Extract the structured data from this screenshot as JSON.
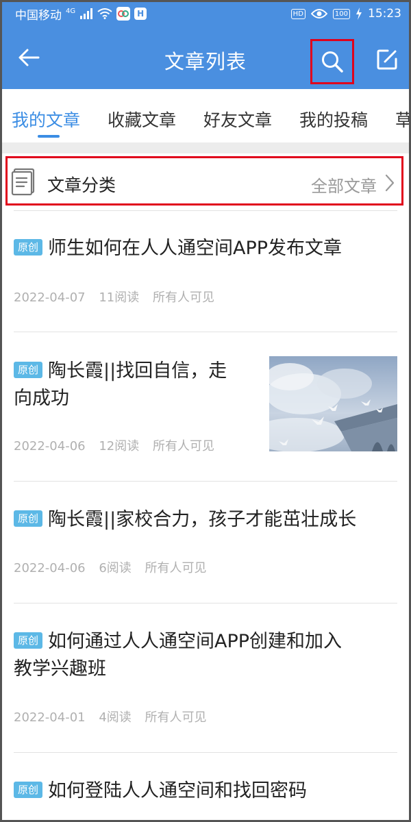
{
  "status_bar": {
    "carrier": "中国移动",
    "network": "4G",
    "hd": "HD",
    "battery": "100",
    "time": "15:23"
  },
  "header": {
    "title": "文章列表",
    "back_icon": "arrow-left-icon",
    "search_icon": "search-icon",
    "edit_icon": "edit-icon"
  },
  "tabs": [
    {
      "label": "我的文章",
      "active": true
    },
    {
      "label": "收藏文章",
      "active": false
    },
    {
      "label": "好友文章",
      "active": false
    },
    {
      "label": "我的投稿",
      "active": false
    },
    {
      "label": "草",
      "active": false
    }
  ],
  "category": {
    "label": "文章分类",
    "value": "全部文章"
  },
  "articles": [
    {
      "badge": "原创",
      "title": "师生如何在人人通空间APP发布文章",
      "date": "2022-04-07",
      "reads": "11阅读",
      "visibility": "所有人可见"
    },
    {
      "badge": "原创",
      "title_line1": "陶长霞||找回自信，走",
      "title_line2": "向成功",
      "date": "2022-04-06",
      "reads": "12阅读",
      "visibility": "所有人可见"
    },
    {
      "badge": "原创",
      "title": "陶长霞||家校合力，孩子才能茁壮成长",
      "date": "2022-04-06",
      "reads": "6阅读",
      "visibility": "所有人可见"
    },
    {
      "badge": "原创",
      "title_line1": "如何通过人人通空间APP创建和加入",
      "title_line2": "教学兴趣班",
      "date": "2022-04-01",
      "reads": "4阅读",
      "visibility": "所有人可见"
    },
    {
      "badge": "原创",
      "title": "如何登陆人人通空间和找回密码"
    }
  ],
  "colors": {
    "primary": "#4a8fe0",
    "tab_active": "#3b8de4",
    "highlight_box": "#e0001b",
    "badge": "#5cb8e6",
    "meta_text": "#b0b0b0"
  }
}
